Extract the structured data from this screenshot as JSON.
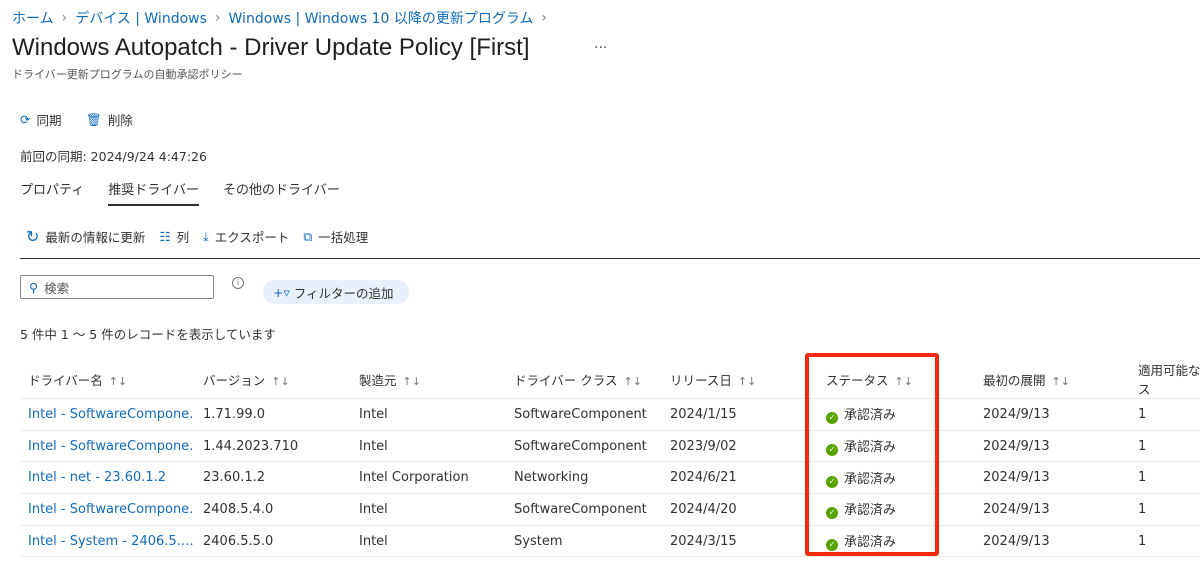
{
  "breadcrumb": [
    "ホーム",
    "デバイス | Windows",
    "Windows | Windows 10 以降の更新プログラム"
  ],
  "title": "Windows Autopatch - Driver Update Policy [First]",
  "more": "···",
  "subtitle": "ドライバー更新プログラムの自動承認ポリシー",
  "actions": {
    "sync": "同期",
    "delete": "削除"
  },
  "last_sync": "前回の同期: 2024/9/24 4:47:26",
  "tabs": [
    "プロパティ",
    "推奨ドライバー",
    "その他のドライバー"
  ],
  "toolbar": {
    "refresh": "最新の情報に更新",
    "columns": "列",
    "export": "エクスポート",
    "bulk": "一括処理"
  },
  "search": {
    "placeholder": "検索"
  },
  "filter": "フィルターの追加",
  "record_count": "5 件中 1 ～ 5 件のレコードを表示しています",
  "columns": [
    "ドライバー名",
    "バージョン",
    "製造元",
    "ドライバー クラス",
    "リリース日",
    "ステータス",
    "最初の展開",
    "適用可能なデバイス"
  ],
  "rows": [
    [
      "Intel - SoftwareCompone…",
      "1.71.99.0",
      "Intel",
      "SoftwareComponent",
      "2024/1/15",
      "承認済み",
      "2024/9/13",
      "1"
    ],
    [
      "Intel - SoftwareCompone…",
      "1.44.2023.710",
      "Intel",
      "SoftwareComponent",
      "2023/9/02",
      "承認済み",
      "2024/9/13",
      "1"
    ],
    [
      "Intel - net - 23.60.1.2",
      "23.60.1.2",
      "Intel Corporation",
      "Networking",
      "2024/6/21",
      "承認済み",
      "2024/9/13",
      "1"
    ],
    [
      "Intel - SoftwareCompone…",
      "2408.5.4.0",
      "Intel",
      "SoftwareComponent",
      "2024/4/20",
      "承認済み",
      "2024/9/13",
      "1"
    ],
    [
      "Intel - System - 2406.5.…",
      "2406.5.5.0",
      "Intel",
      "System",
      "2024/3/15",
      "承認済み",
      "2024/9/13",
      "1"
    ]
  ],
  "colors": {
    "link": "#0f6cbd",
    "approved": "#57a300",
    "highlight": "#f52a0c"
  }
}
